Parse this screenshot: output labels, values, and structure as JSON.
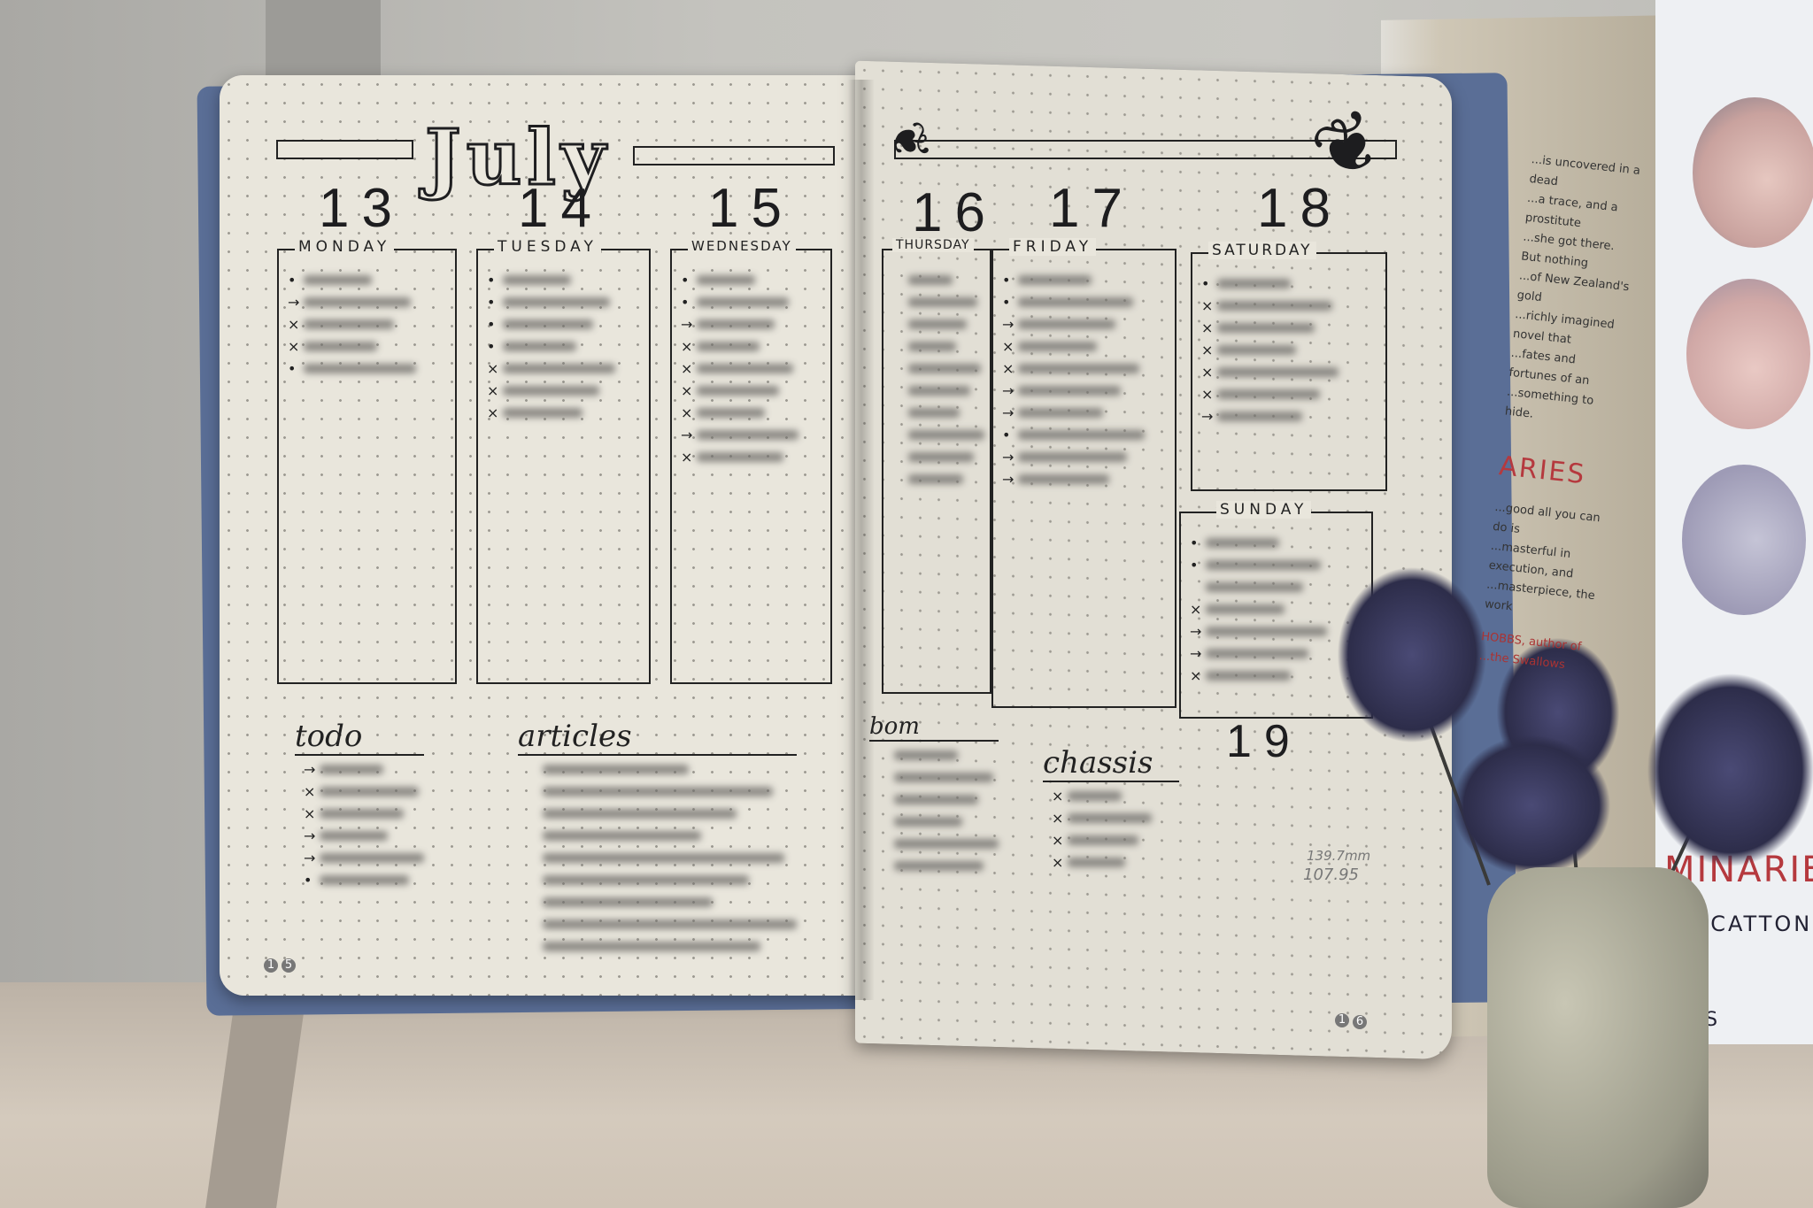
{
  "journal": {
    "month_title": "July",
    "left_page": {
      "days": [
        {
          "number": "13",
          "name": "MONDAY",
          "marks": [
            "•",
            "→",
            "×",
            "×",
            "•"
          ]
        },
        {
          "number": "14",
          "name": "TUESDAY",
          "marks": [
            "•",
            "•",
            "•",
            "•",
            "×",
            "×",
            "×"
          ]
        },
        {
          "number": "15",
          "name": "WEDNESDAY",
          "marks": [
            "•",
            "•",
            "→",
            "×",
            "×",
            "×",
            "×",
            "→",
            "×"
          ]
        }
      ],
      "lists": [
        {
          "title": "todo",
          "marks": [
            "→",
            "×",
            "×",
            "→",
            "→",
            "•"
          ]
        },
        {
          "title": "articles",
          "marks": [
            "",
            "",
            "",
            "",
            "",
            "",
            "",
            "",
            ""
          ]
        }
      ],
      "page_number": [
        "1",
        "5"
      ]
    },
    "right_page": {
      "days": [
        {
          "number": "16",
          "name": "THURSDAY",
          "marks": [
            "",
            "",
            "",
            "",
            "",
            "",
            "",
            "",
            "",
            ""
          ]
        },
        {
          "number": "17",
          "name": "FRIDAY",
          "marks": [
            "•",
            "•",
            "→",
            "×",
            "×",
            "→",
            "→",
            "•",
            "→",
            "→"
          ]
        },
        {
          "number": "18",
          "name": "SATURDAY",
          "marks": [
            "•",
            "×",
            "×",
            "×",
            "×",
            "×",
            "→"
          ]
        },
        {
          "number": "19",
          "name": "SUNDAY",
          "marks": [
            "•",
            "•",
            "",
            "×",
            "→",
            "→",
            "×"
          ]
        }
      ],
      "lists": [
        {
          "title": "bom",
          "marks": [
            "",
            "",
            "",
            "",
            "",
            ""
          ]
        },
        {
          "title": "chassis",
          "marks": [
            "×",
            "×",
            "×",
            "×"
          ]
        }
      ],
      "notes": [
        "139.7mm",
        "107.95"
      ],
      "page_number": [
        "1",
        "6"
      ]
    }
  },
  "background_book": {
    "blurb_lines": [
      "...is uncovered in a dead",
      "...a trace, and a prostitute",
      "...she got there. But nothing",
      "...of New Zealand's gold",
      "...richly imagined novel that",
      "...fates and fortunes of an",
      "...something to hide."
    ],
    "spine_title": "ARIES",
    "review_lines": [
      "...good all you can do is",
      "...masterful in execution, and",
      "...masterpiece, the work"
    ],
    "review_credit": "HOBBS, author of",
    "review_credit_2": "...the Swallows",
    "cover_title": "MINARIES",
    "cover_author": "OR CATTON",
    "publisher": "M&S"
  }
}
